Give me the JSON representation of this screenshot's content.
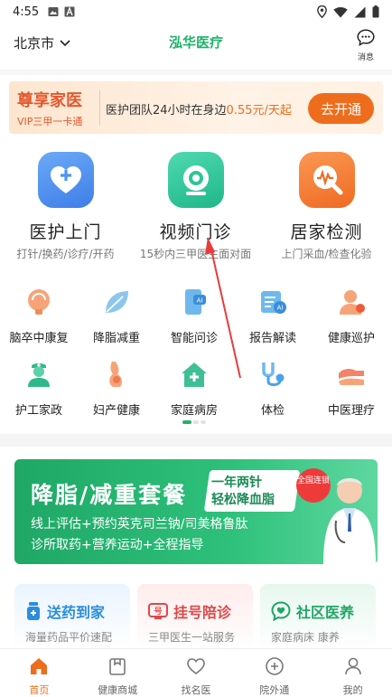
{
  "status_bar": {
    "time": "4:55"
  },
  "header": {
    "city": "北京市",
    "title": "泓华医疗",
    "message_label": "消息"
  },
  "vip_banner": {
    "title": "尊享家医",
    "subtitle": "VIP三甲一卡通",
    "desc_prefix": "医护团队24小时在身边",
    "price": "0.55元/天起",
    "button": "去开通"
  },
  "services": [
    {
      "title": "医护上门",
      "sub": "打针/换药/诊疗/开药",
      "icon": "heart-plus-icon",
      "color": "#4d93f2"
    },
    {
      "title": "视频门诊",
      "sub": "15秒内三甲医生面对面",
      "icon": "video-camera-icon",
      "color": "#2ec597"
    },
    {
      "title": "居家检测",
      "sub": "上门采血/检查化验",
      "icon": "test-magnifier-icon",
      "color": "#f27a2f"
    }
  ],
  "grid": [
    {
      "label": "脑卒中康复",
      "icon": "brain-icon"
    },
    {
      "label": "降脂减重",
      "icon": "leaf-icon"
    },
    {
      "label": "智能问诊",
      "icon": "ai-phone-icon"
    },
    {
      "label": "报告解读",
      "icon": "ai-report-icon"
    },
    {
      "label": "健康巡护",
      "icon": "patrol-person-icon"
    },
    {
      "label": "护工家政",
      "icon": "nurse-icon"
    },
    {
      "label": "妇产健康",
      "icon": "pregnancy-icon"
    },
    {
      "label": "家庭病房",
      "icon": "house-plus-icon"
    },
    {
      "label": "体检",
      "icon": "stethoscope-icon"
    },
    {
      "label": "中医理疗",
      "icon": "massage-hands-icon"
    }
  ],
  "promo": {
    "headline": "降脂/减重套餐",
    "tag_line1": "一年两针",
    "tag_line2": "轻松降血脂",
    "badge": "全国连锁",
    "line1": "线上评估+预约英克司兰钠/司美格鲁肽",
    "line2": "诊所取药+营养运动+全程指导"
  },
  "cards": [
    {
      "title": "送药到家",
      "sub": "海量药品平价速配",
      "icon": "medicine-bottle-icon",
      "color": "#2a8de0"
    },
    {
      "title": "挂号陪诊",
      "sub": "三甲医生一站服务",
      "icon": "register-icon",
      "color": "#e04848"
    },
    {
      "title": "社区医养",
      "sub": "家庭病床 康养",
      "icon": "heart-chat-icon",
      "color": "#1fa766"
    }
  ],
  "tabs": [
    {
      "label": "首页",
      "icon": "home-icon",
      "active": true
    },
    {
      "label": "健康商城",
      "icon": "shop-bag-icon",
      "active": false
    },
    {
      "label": "找名医",
      "icon": "heart-outline-icon",
      "active": false
    },
    {
      "label": "院外通",
      "icon": "plus-circle-icon",
      "active": false
    },
    {
      "label": "我的",
      "icon": "person-icon",
      "active": false
    }
  ],
  "colors": {
    "accent": "#ee6d1c",
    "brand_green": "#1fb26a"
  }
}
